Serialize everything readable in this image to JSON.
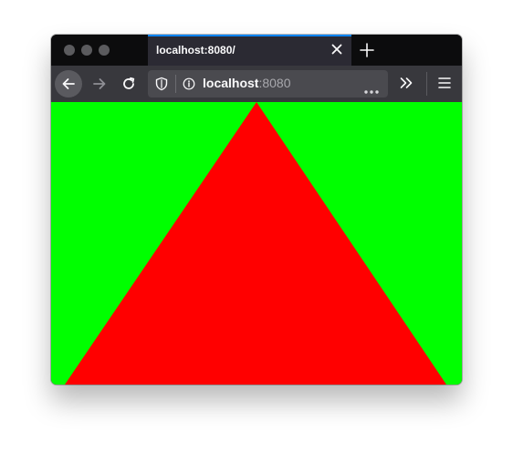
{
  "tab": {
    "title": "localhost:8080/"
  },
  "urlbar": {
    "host": "localhost",
    "port": ":8080"
  },
  "icons": {
    "traffic_lights": [
      "close-dot",
      "minimize-dot",
      "zoom-dot"
    ],
    "tab_close": "close-icon",
    "new_tab": "plus-icon",
    "back": "arrow-left-icon",
    "forward": "arrow-right-icon",
    "reload": "reload-icon",
    "tracking_protection": "shield-icon",
    "site_info": "info-icon",
    "page_actions": "more-horizontal-icon",
    "overflow": "chevron-double-right-icon",
    "menu": "hamburger-menu-icon"
  },
  "colors": {
    "canvas_background": "#00ff00",
    "triangle_fill": "#ff0000",
    "tab_accent": "#0a84ff"
  }
}
